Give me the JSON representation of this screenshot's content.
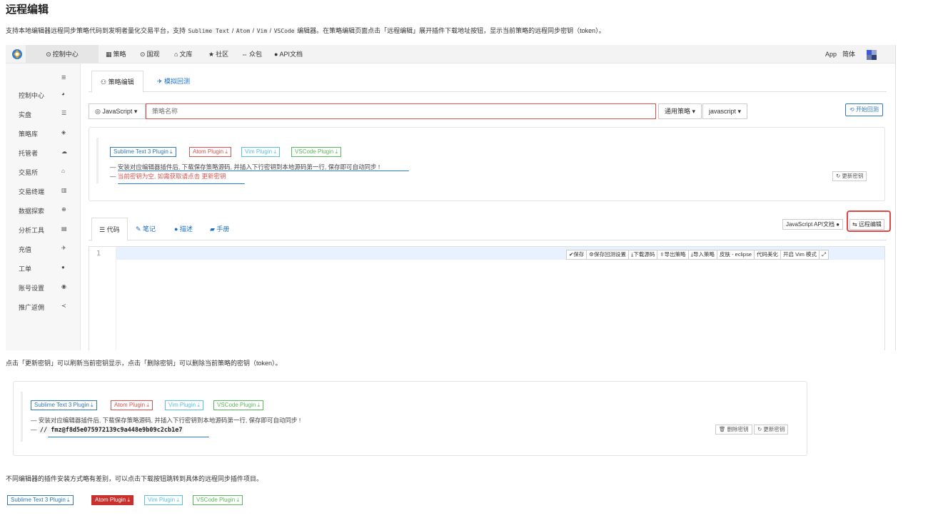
{
  "doc": {
    "title": "远程编辑",
    "intro_before": "支持本地编辑器远程同步策略代码到发明者量化交易平台，支持",
    "intro_code": "Sublime Text",
    "intro_sep1": "/",
    "intro_code2": "Atom",
    "intro_sep2": "/",
    "intro_code3": "Vim",
    "intro_sep3": "/",
    "intro_code4": "VSCode",
    "intro_after": "编辑器。在策略编辑页面点击「远程编辑」展开插件下载地址按钮，显示当前策略的远程同步密钥（token）。",
    "para2": "点击「更新密钥」可以刷新当前密钥显示，点击「删除密钥」可以删除当前策略的密钥（token）。",
    "para3": "不同编辑器的插件安装方式略有差别，可以点击下载按钮跳转到具体的远程同步插件项目。"
  },
  "topnav": {
    "control": "控制中心",
    "items": [
      "策略",
      "国观",
      "文库",
      "社区",
      "众包",
      "API文档"
    ],
    "app": "App",
    "lang": "简体"
  },
  "sidebar": {
    "items": [
      "控制中心",
      "实盘",
      "策略库",
      "托管者",
      "交易所",
      "交易终端",
      "数据探索",
      "分析工具",
      "充值",
      "工单",
      "账号设置",
      "推广返佣"
    ]
  },
  "tabs_top": {
    "edit": "策略编辑",
    "backtest": "模拟回测"
  },
  "editor_bar": {
    "lang": "JavaScript",
    "name_placeholder": "策略名称",
    "type": "通用策略",
    "syntax": "javascript",
    "start_backtest": "开始回测"
  },
  "plugins": {
    "sublime": "Sublime Text 3 Plugin",
    "atom": "Atom Plugin",
    "vim": "Vim Plugin",
    "vscode": "VSCode Plugin"
  },
  "panel1": {
    "hint1": "安装对应编辑器插件后, 下载保存策略源码, 并插入下行密钥到本地源码第一行, 保存即可自动同步 !",
    "hint2": "当前密钥为空, 如需获取请点击 更新密钥",
    "dash": "—",
    "refresh": "更新密钥"
  },
  "tabs_mid": {
    "code": "代码",
    "notes": "笔记",
    "desc": "描述",
    "manual": "手册",
    "api": "JavaScript API文档",
    "remote": "远程编辑"
  },
  "editor": {
    "line": "1",
    "toolbar": [
      "保存",
      "保存回测设置",
      "下载源码",
      "导出策略",
      "导入策略",
      "皮肤 - eclipse",
      "代码美化",
      "开启 Vim 模式",
      "⤢"
    ]
  },
  "panel2": {
    "hint1": "安装对应编辑器插件后, 下载保存策略源码, 并插入下行密钥到本地源码第一行, 保存即可自动同步 !",
    "token": "// fmz@f8d5e075972139c9a448e9b09c2cb1e7",
    "delete": "删除密钥",
    "refresh": "更新密钥"
  },
  "colors": {
    "accent_blue": "#337ab7",
    "danger_red": "#d9534f",
    "highlight_red": "#e04848",
    "underline_blue": "#2a7fd4"
  }
}
